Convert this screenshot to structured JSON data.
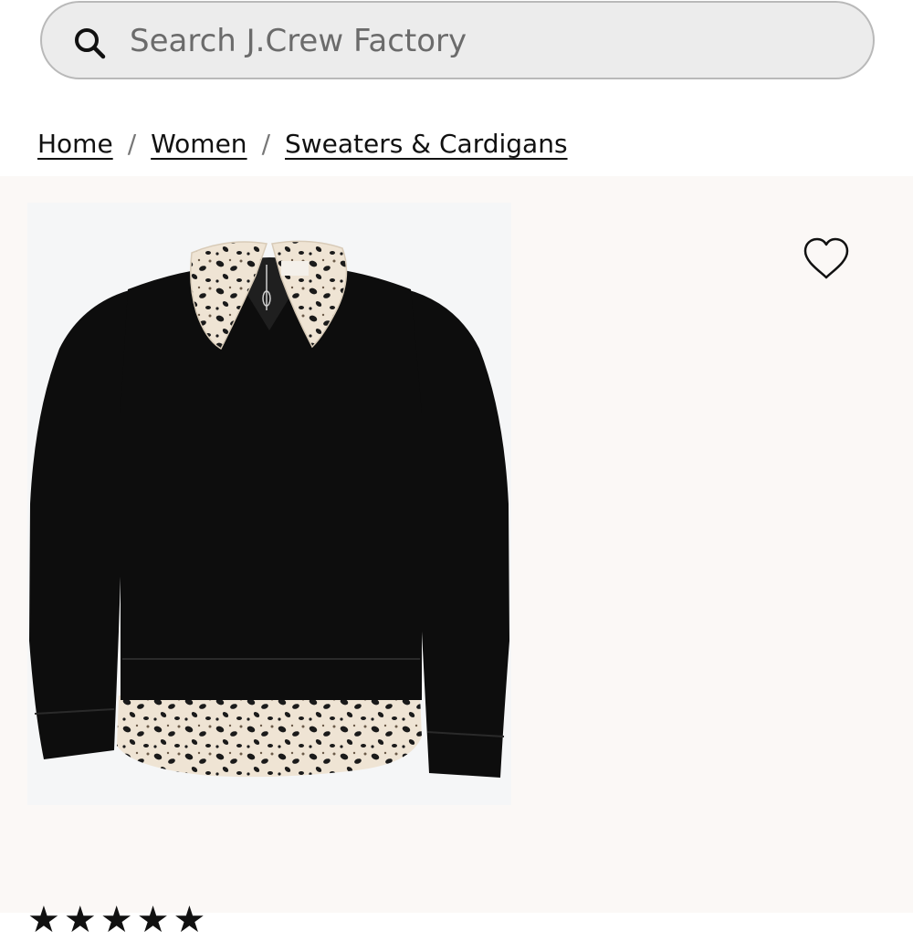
{
  "search": {
    "placeholder": "Search J.Crew Factory",
    "icon": "search-icon"
  },
  "breadcrumb": {
    "items": [
      "Home",
      "Women",
      "Sweaters & Cardigans"
    ],
    "separator": "/"
  },
  "product": {
    "image_alt": "Black sweater with leopard-print collar and hem",
    "wishlist_icon": "heart-outline-icon",
    "rating_stars": "★★★★★"
  },
  "colors": {
    "search_bg": "#ececec",
    "product_bg": "#fbf8f6",
    "sweater": "#0d0d0d",
    "print_base": "#efe4d4",
    "print_spot": "#1a1a1a"
  }
}
